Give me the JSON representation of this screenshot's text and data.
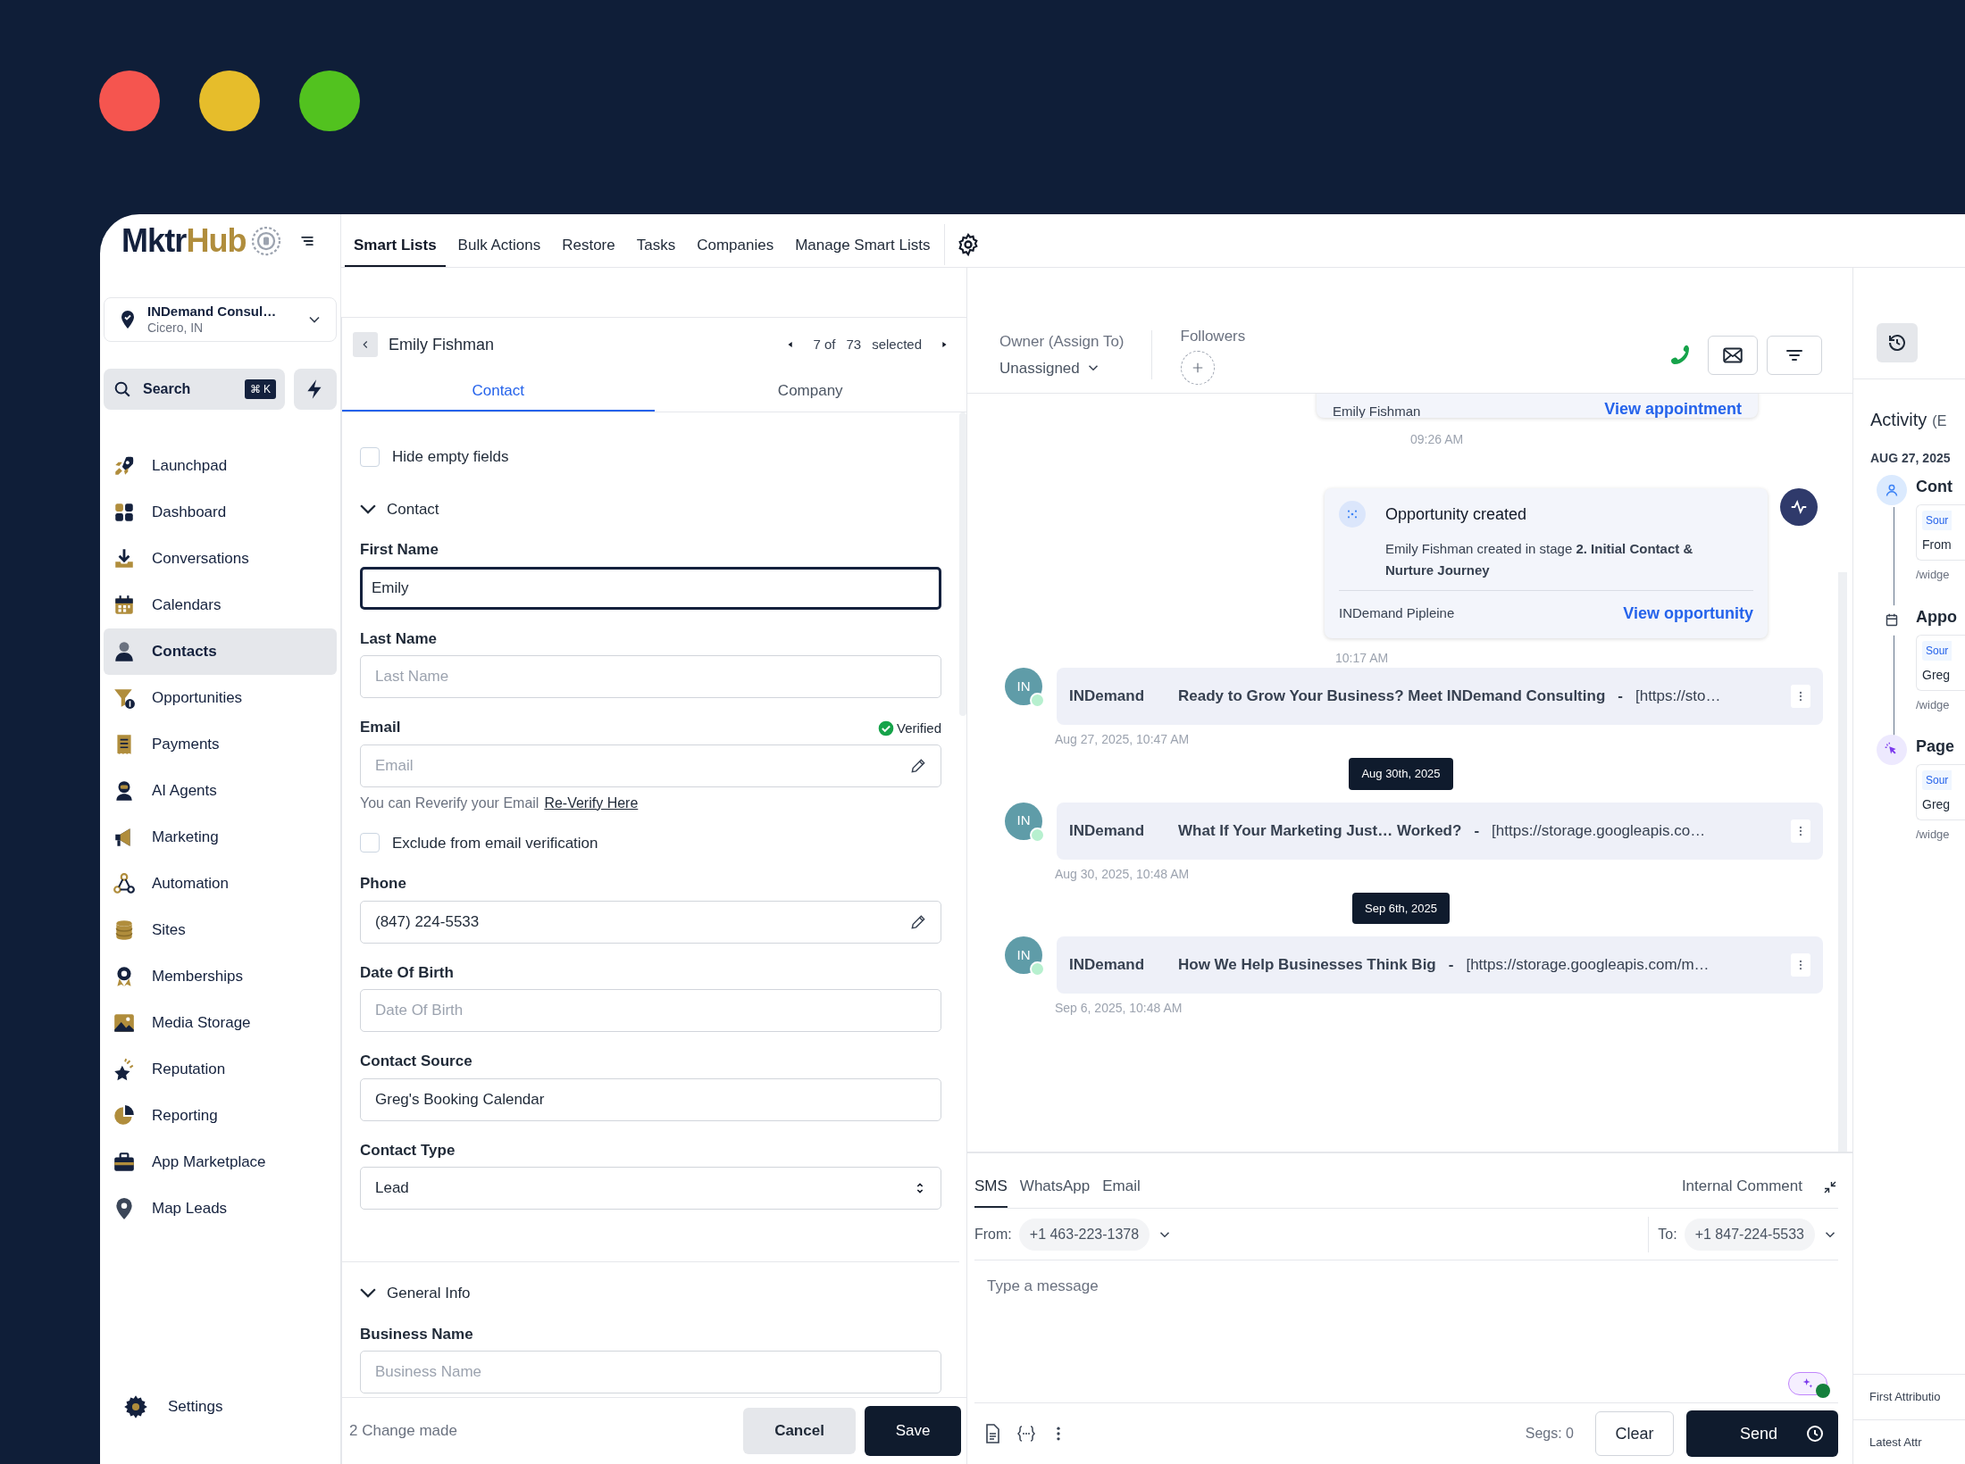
{
  "window_controls": [
    {
      "color": "#f5554f"
    },
    {
      "color": "#e6bd2b"
    },
    {
      "color": "#52c21f"
    }
  ],
  "logo": {
    "dark": "Mktr",
    "gold": "Hub"
  },
  "top_nav": {
    "tabs": [
      {
        "label": "Smart Lists",
        "selected": true
      },
      {
        "label": "Bulk Actions",
        "selected": false
      },
      {
        "label": "Restore",
        "selected": false
      },
      {
        "label": "Tasks",
        "selected": false
      },
      {
        "label": "Companies",
        "selected": false
      },
      {
        "label": "Manage Smart Lists",
        "selected": false
      }
    ]
  },
  "location": {
    "name": "INDemand Consul…",
    "city": "Cicero, IN"
  },
  "search": {
    "label": "Search",
    "shortcut": "⌘ K"
  },
  "sidebar": {
    "items": [
      {
        "label": "Launchpad",
        "selected": false
      },
      {
        "label": "Dashboard",
        "selected": false
      },
      {
        "label": "Conversations",
        "selected": false
      },
      {
        "label": "Calendars",
        "selected": false
      },
      {
        "label": "Contacts",
        "selected": true
      },
      {
        "label": "Opportunities",
        "selected": false
      },
      {
        "label": "Payments",
        "selected": false
      },
      {
        "label": "AI Agents",
        "selected": false
      },
      {
        "label": "Marketing",
        "selected": false
      },
      {
        "label": "Automation",
        "selected": false
      },
      {
        "label": "Sites",
        "selected": false
      },
      {
        "label": "Memberships",
        "selected": false
      },
      {
        "label": "Media Storage",
        "selected": false
      },
      {
        "label": "Reputation",
        "selected": false
      },
      {
        "label": "Reporting",
        "selected": false
      },
      {
        "label": "App Marketplace",
        "selected": false
      },
      {
        "label": "Map Leads",
        "selected": false
      }
    ],
    "settings": "Settings"
  },
  "contact_panel": {
    "name": "Emily Fishman",
    "pager": {
      "position": "7 of",
      "total": "73",
      "suffix": "selected"
    },
    "tabs": [
      {
        "label": "Contact",
        "selected": true
      },
      {
        "label": "Company",
        "selected": false
      }
    ],
    "hide_empty": {
      "label": "Hide empty fields",
      "checked": false
    },
    "sections": [
      {
        "title": "Contact",
        "expanded": true,
        "fields": [
          {
            "kind": "text",
            "label": "First Name",
            "value": "Emily",
            "focused": true
          },
          {
            "kind": "text",
            "label": "Last Name",
            "placeholder": "Last Name",
            "focused": false
          },
          {
            "kind": "email",
            "label": "Email",
            "badge": "Verified",
            "placeholder": "Email",
            "hint": "You can Reverify your Email",
            "link": "Re-Verify Here",
            "exclude": {
              "label": "Exclude from email verification",
              "checked": false
            },
            "focused": false
          },
          {
            "kind": "editable",
            "label": "Phone",
            "value": "(847) 224-5533",
            "focused": false
          },
          {
            "kind": "text",
            "label": "Date Of Birth",
            "placeholder": "Date Of Birth",
            "focused": false
          },
          {
            "kind": "text",
            "label": "Contact Source",
            "value": "Greg's Booking Calendar",
            "focused": false
          },
          {
            "kind": "select",
            "label": "Contact Type",
            "value": "Lead",
            "focused": false
          }
        ]
      },
      {
        "title": "General Info",
        "expanded": true,
        "fields": [
          {
            "kind": "text",
            "label": "Business Name",
            "placeholder": "Business Name",
            "focused": false
          }
        ]
      }
    ],
    "footer": {
      "changes": "2 Change made",
      "cancel": "Cancel",
      "save": "Save"
    }
  },
  "conversation": {
    "owner_label": "Owner (Assign To)",
    "owner": "Unassigned",
    "followers_label": "Followers",
    "timeline": [
      {
        "kind": "partial_card",
        "name": "Emily Fishman",
        "link": "View appointment",
        "time": "09:26 AM"
      },
      {
        "kind": "opportunity",
        "title": "Opportunity created",
        "body": "Emily Fishman created in stage **2. Initial Contact & Nurture Journey**",
        "pipeline": "INDemand Pipleine",
        "link": "View opportunity",
        "time": "10:17 AM"
      },
      {
        "kind": "email",
        "avatar": "IN",
        "sender": "INDemand",
        "subject": "Ready to Grow Your Business? Meet INDemand Consulting",
        "separator": "-",
        "link": "[https://sto…",
        "time": "Aug 27, 2025, 10:47 AM"
      },
      {
        "kind": "date",
        "label": "Aug 30th, 2025"
      },
      {
        "kind": "email",
        "avatar": "IN",
        "sender": "INDemand",
        "subject": "What If Your Marketing Just… Worked?",
        "separator": "-",
        "link": "[https://storage.googleapis.co…",
        "time": "Aug 30, 2025, 10:48 AM"
      },
      {
        "kind": "date",
        "label": "Sep 6th, 2025"
      },
      {
        "kind": "email",
        "avatar": "IN",
        "sender": "INDemand",
        "subject": "How We Help Businesses Think Big",
        "separator": "-",
        "link": "[https://storage.googleapis.com/m…",
        "time": "Sep 6, 2025, 10:48 AM"
      }
    ],
    "composer": {
      "tabs": [
        {
          "label": "SMS",
          "selected": true
        },
        {
          "label": "WhatsApp",
          "selected": false
        },
        {
          "label": "Email",
          "selected": false
        }
      ],
      "internal": "Internal Comment",
      "from_label": "From:",
      "from": "+1 463-223-1378",
      "to_label": "To:",
      "to": "+1 847-224-5533",
      "placeholder": "Type a message",
      "segs": "Segs: 0",
      "clear": "Clear",
      "send": "Send"
    }
  },
  "activity": {
    "title": "Activity",
    "filter": "(E",
    "date": "AUG 27, 2025",
    "entries": [
      {
        "title": "Cont",
        "tag": "Sour",
        "text": "From",
        "path": "/widge"
      },
      {
        "title": "Appo",
        "tag": "Sour",
        "text": "Greg",
        "path": "/widge"
      },
      {
        "title": "Page",
        "tag": "Sour",
        "text": "Greg",
        "path": "/widge"
      }
    ],
    "footer": [
      "First Attributio",
      "Latest Attr"
    ]
  }
}
